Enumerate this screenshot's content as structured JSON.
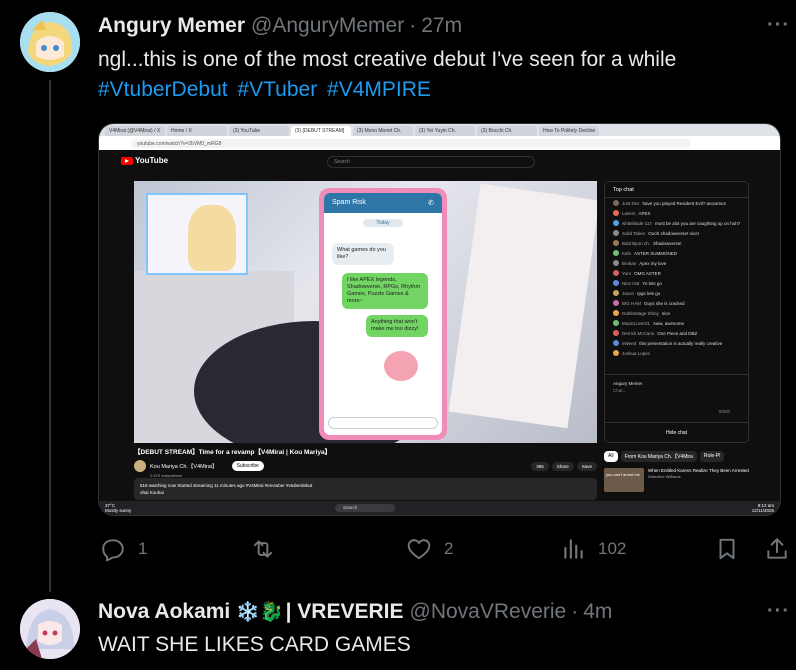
{
  "tweet1": {
    "display_name": "Angury Memer",
    "handle": "@AnguryMemer",
    "separator": "·",
    "time": "27m",
    "text": "ngl...this is one of the most creative debut I've seen for a while",
    "hashtags": [
      "#VtuberDebut",
      "#VTuber",
      "#V4MPIRE"
    ],
    "more_label": "···",
    "actions": {
      "reply_count": "1",
      "retweet_count": "",
      "like_count": "2",
      "view_count": "102"
    },
    "avatar_color": "#bfe7d9"
  },
  "tweet2": {
    "display_name": "Nova Aokami",
    "name_emoji": "❄️🐉",
    "name_suffix": "| VREVERIE",
    "handle": "@NovaVReverie",
    "separator": "·",
    "time": "4m",
    "text": "WAIT SHE LIKES CARD GAMES",
    "more_label": "···",
    "avatar_color": "#d8cbe6"
  },
  "screenshot": {
    "tabs": [
      "V4Mirai (@V4Mirai) / X",
      "Home / X",
      "(3) YouTube",
      "(3) [DEBUT STREAM]",
      "(3) Mono Monet Ch.",
      "(3) Yei Yuyin Ch.",
      "(3) Bocchi Ch.",
      "How To Politely Decline"
    ],
    "url": "youtube.com/watch?v=2bVM0_mRG8",
    "youtube_label": "YouTube",
    "search_placeholder": "Search",
    "phone": {
      "header": "Spam Risk",
      "today": "Today",
      "msg1": "What games do you like?",
      "msg2": "I like APEX legends, Shadowverse, RPGs, Rhythm Games, Puzzle Games & more~",
      "msg3": "Anything that won't make me too dizzy!"
    },
    "chat": {
      "title": "Top chat",
      "messages": [
        {
          "name": "Just Dez",
          "text": "have you played Resident Evil? anowmus",
          "color": "#7a6a5a"
        },
        {
          "name": "Lasers",
          "text": "APEX",
          "color": "#e86a4f"
        },
        {
          "name": "whiteblade 117",
          "text": "must be alot you are caughting up on huh?",
          "color": "#4fa3e8"
        },
        {
          "name": "Solid Takeo",
          "text": "Oooh shadowverse! nice!",
          "color": "#8a8a8a"
        },
        {
          "name": "Bald Bjorn ch.",
          "text": "Shadowverse!",
          "color": "#9a7c5a"
        },
        {
          "name": "Kahi",
          "text": "ASTER SUMMONED",
          "color": "#6fbf73"
        },
        {
          "name": "Brokan",
          "text": "Apex my love",
          "color": "#8a8a8a"
        },
        {
          "name": "Yoro",
          "text": "OMG ASTER",
          "color": "#d95f5f"
        },
        {
          "name": "Nice Hat",
          "text": "Yo lets go",
          "color": "#5f8ad9"
        },
        {
          "name": "Jason",
          "text": "rpgs lets go",
          "color": "#c9a25f"
        },
        {
          "name": "BIG HAM",
          "text": "Guys she is cracked",
          "color": "#c96bb0"
        },
        {
          "name": "GoblinMage Shiny",
          "text": "nice",
          "color": "#e8a34f"
        },
        {
          "name": "MusicLover31",
          "text": "Aww, awesome",
          "color": "#6fbf73"
        },
        {
          "name": "Derrick McCann",
          "text": "One Piece and DBZ",
          "color": "#d95f5f"
        },
        {
          "name": "eWeed",
          "text": "this presentation is actually really creative",
          "color": "#5f8ad9"
        },
        {
          "name": "Joshua Lopez",
          "text": "",
          "color": "#e8a34f"
        }
      ],
      "input_name": "Angury Memer",
      "input_placeholder": "Chat...",
      "counter": "0/500",
      "hide_label": "Hide chat"
    },
    "video_title": "【DEBUT STREAM】Time for a revamp【V4Mirai | Kou Mariya】",
    "channel_name": "Kou Mariya Ch.【V4Mirai】",
    "channel_subs": "2.67K subscribers",
    "subscribe_label": "Subscribe",
    "like_count": "365",
    "share_label": "Share",
    "save_label": "Save",
    "description": "519 watching now  Started streaming 11 minutes ago  #V4Mirai #envtuber #vtuberdebut",
    "description2": "ohai Kouhai",
    "rec_chips": [
      "All",
      "From Kou Mariya Ch.【V4Mira",
      "Role-Pl"
    ],
    "rec_title": "When Entitled Karens Realize They Been Arrested",
    "rec_channel": "Detective Williams",
    "rec_thumb_text": "you can't arrest me",
    "taskbar_search": "Search",
    "weather_temp": "37°C",
    "weather_desc": "Mostly sunny",
    "clock_time": "8:12 am",
    "clock_date": "12/11/2025"
  }
}
